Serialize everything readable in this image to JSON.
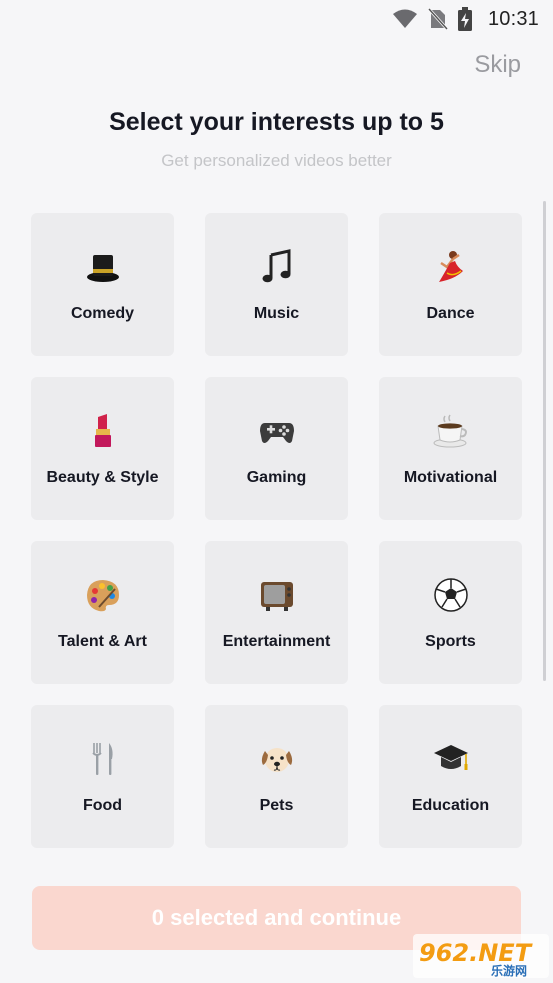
{
  "status_bar": {
    "time": "10:31",
    "icons": [
      "wifi-icon",
      "no-sim-icon",
      "battery-charging-icon"
    ]
  },
  "header": {
    "skip_label": "Skip",
    "title": "Select your interests up to 5",
    "subtitle": "Get personalized videos better"
  },
  "interests": [
    {
      "label": "Comedy",
      "icon": "top-hat-icon"
    },
    {
      "label": "Music",
      "icon": "music-note-icon"
    },
    {
      "label": "Dance",
      "icon": "dancer-icon"
    },
    {
      "label": "Beauty & Style",
      "icon": "lipstick-icon"
    },
    {
      "label": "Gaming",
      "icon": "game-controller-icon"
    },
    {
      "label": "Motivational",
      "icon": "coffee-icon"
    },
    {
      "label": "Talent & Art",
      "icon": "palette-icon"
    },
    {
      "label": "Entertainment",
      "icon": "television-icon"
    },
    {
      "label": "Sports",
      "icon": "soccer-ball-icon"
    },
    {
      "label": "Food",
      "icon": "fork-knife-icon"
    },
    {
      "label": "Pets",
      "icon": "dog-icon"
    },
    {
      "label": "Education",
      "icon": "graduation-cap-icon"
    }
  ],
  "footer": {
    "continue_label": "0 selected and continue"
  },
  "watermark": {
    "brand": "962.NET",
    "sub": "乐游网"
  },
  "colors": {
    "background": "#f6f6f8",
    "card": "#ececee",
    "continue_disabled": "#fad7cf",
    "skip": "#9a9ba0",
    "subtitle": "#c4c5c8"
  }
}
